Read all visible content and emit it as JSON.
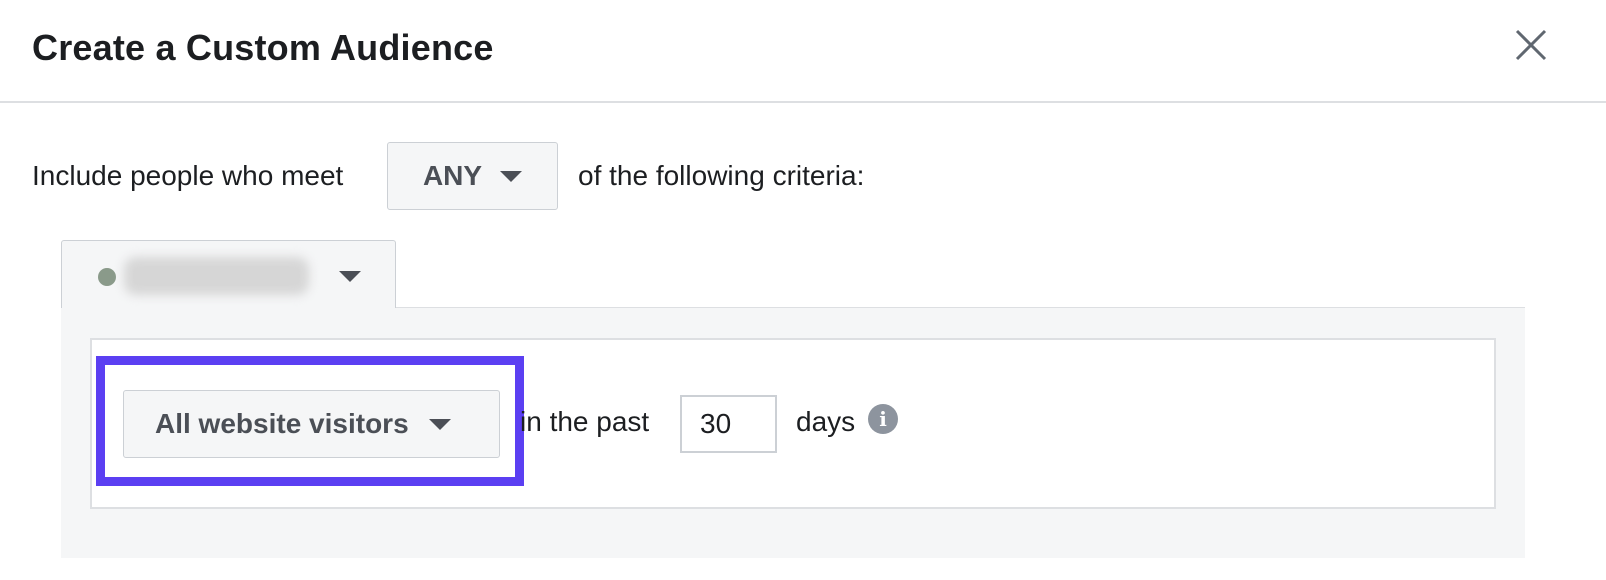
{
  "dialog": {
    "title": "Create a Custom Audience",
    "close_icon": "close-icon"
  },
  "criteria": {
    "prefix": "Include people who meet",
    "match_selected": "ANY",
    "suffix": "of the following criteria:"
  },
  "source": {
    "status_dot_color": "#8a9a8a",
    "label_redacted": true
  },
  "rule": {
    "audience_selected": "All website visitors",
    "past_text": "in the past",
    "days_value": "30",
    "days_label": "days",
    "info_icon": "info-icon",
    "highlight_color": "#5b3ff2"
  }
}
